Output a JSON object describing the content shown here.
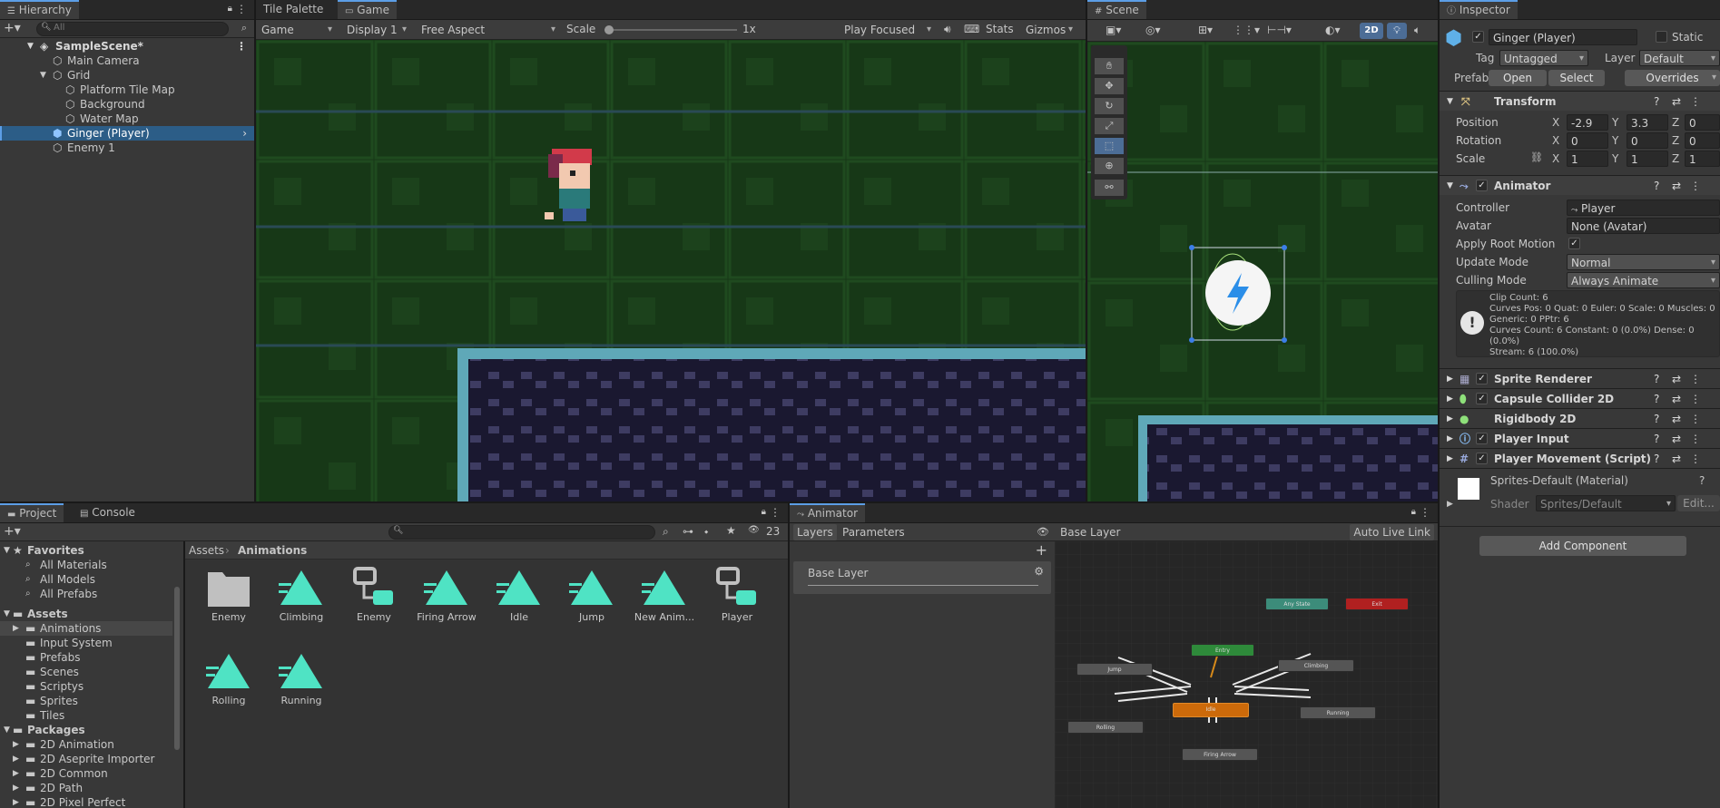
{
  "hierarchy": {
    "tab": "Hierarchy",
    "search_placeholder": "All",
    "scene": "SampleScene*",
    "items": [
      "Main Camera",
      "Grid",
      "Platform Tile Map",
      "Background",
      "Water Map",
      "Ginger (Player)",
      "Enemy 1"
    ]
  },
  "game": {
    "tabs": [
      "Tile Palette",
      "Game"
    ],
    "toolbar": {
      "mode": "Game",
      "display": "Display 1",
      "aspect": "Free Aspect",
      "scale_label": "Scale",
      "scale_value": "1x",
      "play": "Play Focused",
      "stats": "Stats",
      "gizmos": "Gizmos"
    }
  },
  "scene": {
    "tab": "Scene",
    "mode_2d": "2D"
  },
  "inspector": {
    "tab": "Inspector",
    "object_name": "Ginger (Player)",
    "static_label": "Static",
    "tag_label": "Tag",
    "tag_value": "Untagged",
    "layer_label": "Layer",
    "layer_value": "Default",
    "prefab_label": "Prefab",
    "open": "Open",
    "select": "Select",
    "overrides": "Overrides",
    "transform": {
      "title": "Transform",
      "position_label": "Position",
      "position": [
        "-2.9",
        "3.3",
        "0"
      ],
      "rotation_label": "Rotation",
      "rotation": [
        "0",
        "0",
        "0"
      ],
      "scale_label": "Scale",
      "scale": [
        "1",
        "1",
        "1"
      ],
      "axes": [
        "X",
        "Y",
        "Z"
      ]
    },
    "animator": {
      "title": "Animator",
      "controller_label": "Controller",
      "controller": "Player",
      "avatar_label": "Avatar",
      "avatar": "None (Avatar)",
      "root_motion_label": "Apply Root Motion",
      "update_label": "Update Mode",
      "update": "Normal",
      "culling_label": "Culling Mode",
      "culling": "Always Animate",
      "info": [
        "Clip Count: 6",
        "Curves Pos: 0 Quat: 0 Euler: 0 Scale: 0 Muscles: 0",
        "Generic: 0 PPtr: 6",
        "Curves Count: 6 Constant: 0 (0.0%) Dense: 0 (0.0%)",
        "Stream: 6 (100.0%)"
      ]
    },
    "components": [
      "Sprite Renderer",
      "Capsule Collider 2D",
      "Rigidbody 2D",
      "Player Input",
      "Player Movement (Script)"
    ],
    "material": "Sprites-Default (Material)",
    "shader_label": "Shader",
    "shader": "Sprites/Default",
    "edit": "Edit...",
    "add_component": "Add Component"
  },
  "project": {
    "tabs": [
      "Project",
      "Console"
    ],
    "count": "23",
    "favorites_label": "Favorites",
    "favorites": [
      "All Materials",
      "All Models",
      "All Prefabs"
    ],
    "assets_label": "Assets",
    "assets": [
      "Animations",
      "Input System",
      "Prefabs",
      "Scenes",
      "Scriptys",
      "Sprites",
      "Tiles"
    ],
    "packages_label": "Packages",
    "packages": [
      "2D Animation",
      "2D Aseprite Importer",
      "2D Common",
      "2D Path",
      "2D Pixel Perfect"
    ],
    "breadcrumb": [
      "Assets",
      "Animations"
    ],
    "grid": [
      "Enemy",
      "Climbing",
      "Enemy",
      "Firing Arrow",
      "Idle",
      "Jump",
      "New Anim...",
      "Player",
      "Rolling",
      "Running"
    ]
  },
  "animator_window": {
    "tab": "Animator",
    "layers": "Layers",
    "parameters": "Parameters",
    "breadcrumb": "Base Layer",
    "auto_live": "Auto Live Link",
    "layer_item": "Base Layer",
    "nodes": {
      "any": "Any State",
      "exit": "Exit",
      "entry": "Entry",
      "jump": "Jump",
      "climbing": "Climbing",
      "idle": "Idle",
      "rolling": "Rolling",
      "running": "Running",
      "firing": "Firing Arrow"
    }
  }
}
